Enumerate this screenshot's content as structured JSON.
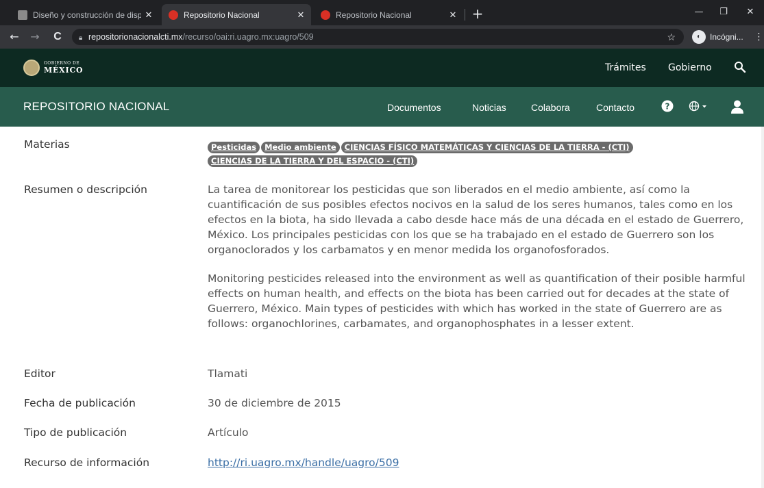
{
  "browser": {
    "tabs": [
      {
        "title": "Diseño y construcción de disposi",
        "active": false
      },
      {
        "title": "Repositorio Nacional",
        "active": true
      },
      {
        "title": "Repositorio Nacional",
        "active": false
      }
    ],
    "new_tab": "+",
    "window_controls": {
      "minimize": "—",
      "maximize": "❐",
      "close": "✕"
    },
    "nav": {
      "back": "←",
      "forward": "→",
      "reload": "C"
    },
    "url": {
      "domain": "repositorionacionalcti.mx",
      "path": "/recurso/oai:ri.uagro.mx:uagro/509"
    },
    "star": "☆",
    "incognito_label": "Incógni...",
    "menu": "⋮"
  },
  "gob_header": {
    "logo_small": "GOBIERNO DE",
    "logo_big": "MÉXICO",
    "links": [
      "Trámites",
      "Gobierno"
    ],
    "search_icon": "search-icon"
  },
  "repo_header": {
    "title": "REPOSITORIO NACIONAL",
    "nav": [
      "Documentos",
      "Noticias",
      "Colabora",
      "Contacto"
    ],
    "icons": [
      "help-icon",
      "globe-icon",
      "user-icon"
    ]
  },
  "record": {
    "materias_label": "Materias",
    "materias": [
      "Pesticidas",
      "Medio ambiente",
      "CIENCIAS FÍSICO MATEMÁTICAS Y CIENCIAS DE LA TIERRA - (CTI)",
      "CIENCIAS DE LA TIERRA Y DEL ESPACIO - (CTI)"
    ],
    "resumen_label": "Resumen o descripción",
    "resumen_es": "La tarea de monitorear los pesticidas que son liberados en el medio ambiente, así como la cuantificación de sus posibles efectos nocivos en la salud de los seres humanos, tales como en los efectos en la biota, ha sido llevada a cabo desde hace más de una década en el estado de Guerrero, México. Los principales pesticidas con los que se ha trabajado en el estado de Guerrero son los organoclorados y los carbamatos y en menor medida los organofosforados.",
    "resumen_en": "Monitoring pesticides released into the environment as well as quantification of their posible harmful effects on human health, and effects on the biota has been carried out for decades at the state of Guerrero, México. Main types of pesticides with which has worked in the state of Guerrero are as follows: organochlorines, carbamates, and organophosphates in a lesser extent.",
    "editor_label": "Editor",
    "editor": "Tlamati",
    "fecha_label": "Fecha de publicación",
    "fecha": "30 de diciembre de 2015",
    "tipo_label": "Tipo de publicación",
    "tipo": "Artículo",
    "recurso_label": "Recurso de información",
    "recurso": "http://ri.uagro.mx/handle/uagro/509"
  }
}
